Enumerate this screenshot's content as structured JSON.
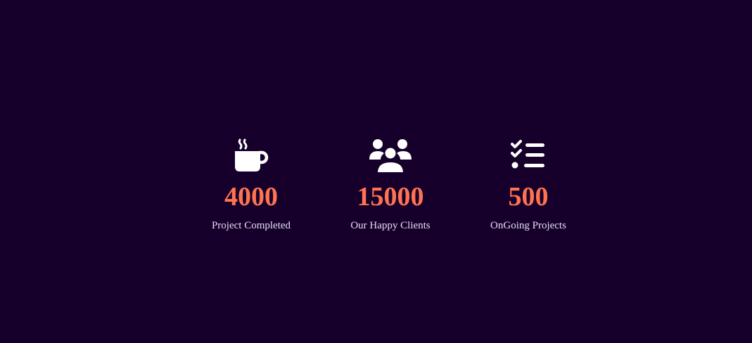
{
  "stats": [
    {
      "icon": "coffee-cup-icon",
      "value": "4000",
      "label": "Project Completed"
    },
    {
      "icon": "users-group-icon",
      "value": "15000",
      "label": "Our Happy Clients"
    },
    {
      "icon": "checklist-icon",
      "value": "500",
      "label": "OnGoing Projects"
    }
  ],
  "colors": {
    "background": "#16002b",
    "accent": "#ff7350",
    "label": "#e6ddf5"
  }
}
